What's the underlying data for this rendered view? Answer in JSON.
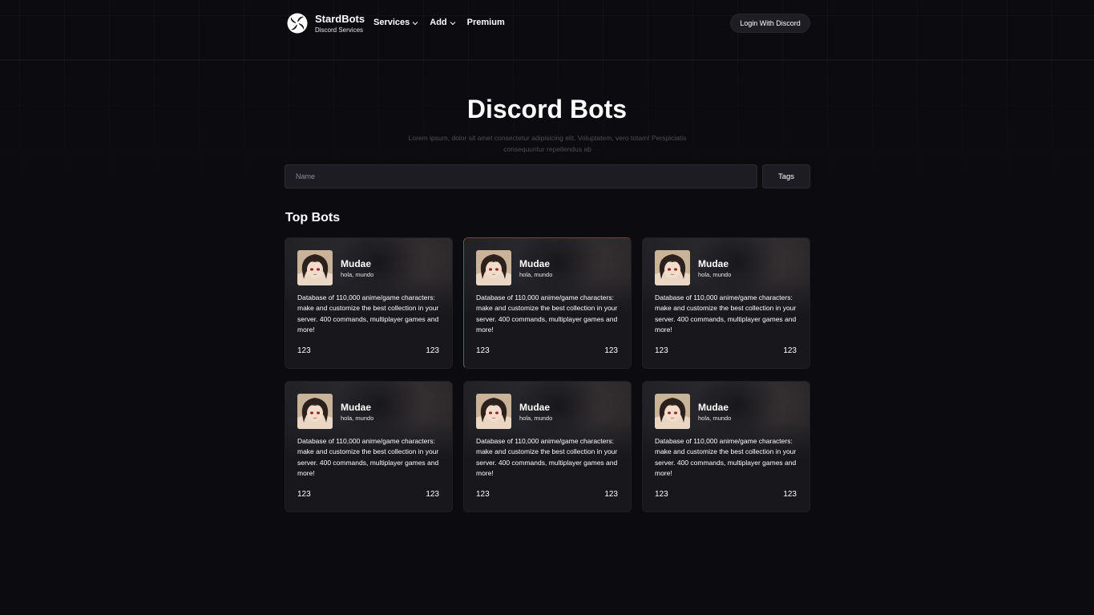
{
  "nav": {
    "brand_name": "StardBots",
    "brand_sub": "Discord Services",
    "menu": [
      {
        "label": "Services",
        "has_dropdown": true
      },
      {
        "label": "Add",
        "has_dropdown": true
      },
      {
        "label": "Premium",
        "has_dropdown": false
      }
    ],
    "login_label": "Login With Discord"
  },
  "hero": {
    "title": "Discord Bots",
    "description": "Lorem ipsum, dolor sit amet consectetur adipisicing elit. Voluptatem, vero totam! Perspiciatis consequuntur repellendus ab"
  },
  "search": {
    "placeholder": "Name",
    "value": "",
    "tags_label": "Tags"
  },
  "section": {
    "title": "Top Bots"
  },
  "bots": [
    {
      "name": "Mudae",
      "tag": "hola, mundo",
      "description": "Database of 110,000 anime/game characters: make and customize the best collection in your server. 400 commands, multiplayer games and more!",
      "stat_left": "123",
      "stat_right": "123"
    },
    {
      "name": "Mudae",
      "tag": "hola, mundo",
      "description": "Database of 110,000 anime/game characters: make and customize the best collection in your server. 400 commands, multiplayer games and more!",
      "stat_left": "123",
      "stat_right": "123"
    },
    {
      "name": "Mudae",
      "tag": "hola, mundo",
      "description": "Database of 110,000 anime/game characters: make and customize the best collection in your server. 400 commands, multiplayer games and more!",
      "stat_left": "123",
      "stat_right": "123"
    },
    {
      "name": "Mudae",
      "tag": "hola, mundo",
      "description": "Database of 110,000 anime/game characters: make and customize the best collection in your server. 400 commands, multiplayer games and more!",
      "stat_left": "123",
      "stat_right": "123"
    },
    {
      "name": "Mudae",
      "tag": "hola, mundo",
      "description": "Database of 110,000 anime/game characters: make and customize the best collection in your server. 400 commands, multiplayer games and more!",
      "stat_left": "123",
      "stat_right": "123"
    },
    {
      "name": "Mudae",
      "tag": "hola, mundo",
      "description": "Database of 110,000 anime/game characters: make and customize the best collection in your server. 400 commands, multiplayer games and more!",
      "stat_left": "123",
      "stat_right": "123"
    }
  ],
  "colors": {
    "background": "#0b0b10",
    "card": "#17171c",
    "input": "#1c1c22",
    "muted_text": "#4d4d56",
    "active_card_border": "#7d5a2c"
  },
  "icons": {
    "logo": "swirl-logo-icon",
    "dropdown": "chevron-down-icon",
    "avatar": "anime-avatar"
  }
}
